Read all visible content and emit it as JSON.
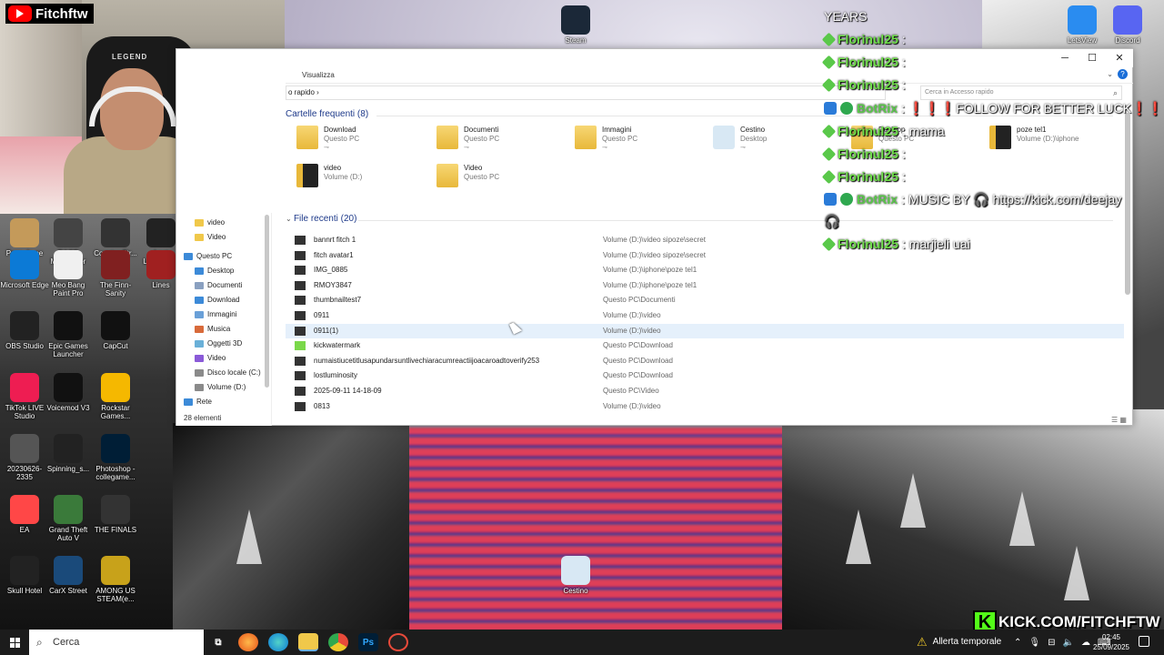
{
  "webcam": {
    "badge": "Fitchftw",
    "chair_text": "LEGEND"
  },
  "desktop_icons": [
    {
      "label": "Steam",
      "color": "#1b2838"
    },
    {
      "label": "LetsView",
      "color": "#2a8cf0"
    },
    {
      "label": "Discord",
      "color": "#5865f2"
    },
    {
      "label": "Poze de pe ipad al",
      "color": "#c49a5a"
    },
    {
      "label": "RAGE Multiplayer",
      "color": "#444"
    },
    {
      "label": "Counter-Str...",
      "color": "#333"
    },
    {
      "label": "Lost Luminosi...",
      "color": "#222"
    },
    {
      "label": "Microsoft Edge",
      "color": "#0c7ad6"
    },
    {
      "label": "Meo Bang Paint Pro",
      "color": "#f0f0f0"
    },
    {
      "label": "The Finn-Sanity",
      "color": "#802020"
    },
    {
      "label": "Lines",
      "color": "#a02020"
    },
    {
      "label": "OBS Studio",
      "color": "#222"
    },
    {
      "label": "Epic Games Launcher",
      "color": "#111"
    },
    {
      "label": "CapCut",
      "color": "#111"
    },
    {
      "label": "TikTok LIVE Studio",
      "color": "#ee1d52"
    },
    {
      "label": "Voicemod V3",
      "color": "#111"
    },
    {
      "label": "Rockstar Games...",
      "color": "#f5b800"
    },
    {
      "label": "20230626-2335",
      "color": "#555"
    },
    {
      "label": "Spinning_s...",
      "color": "#222"
    },
    {
      "label": "Photoshop - collegame...",
      "color": "#001e36"
    },
    {
      "label": "EA",
      "color": "#ff4747"
    },
    {
      "label": "Grand Theft Auto V",
      "color": "#3a7a3a"
    },
    {
      "label": "THE FINALS",
      "color": "#333"
    },
    {
      "label": "Skull Hotel",
      "color": "#222"
    },
    {
      "label": "CarX Street",
      "color": "#1a4a7a"
    },
    {
      "label": "AMONG US STEAM(e...",
      "color": "#c8a21a"
    },
    {
      "label": "Cestino",
      "color": "#d8e8f4"
    }
  ],
  "explorer": {
    "ribbon_tab": "Visualizza",
    "address": "o rapido  ›",
    "search_placeholder": "Cerca in Accesso rapido",
    "nav": [
      {
        "label": "video",
        "color": "#f0c84a"
      },
      {
        "label": "Video",
        "color": "#f0c84a"
      },
      {
        "label": "Questo PC",
        "color": "#3c8ad8"
      },
      {
        "label": "Desktop",
        "color": "#3c8ad8"
      },
      {
        "label": "Documenti",
        "color": "#8aa0c0"
      },
      {
        "label": "Download",
        "color": "#3c8ad8"
      },
      {
        "label": "Immagini",
        "color": "#6aa0d8"
      },
      {
        "label": "Musica",
        "color": "#d86a3a"
      },
      {
        "label": "Oggetti 3D",
        "color": "#6ab0d8"
      },
      {
        "label": "Video",
        "color": "#8a5ad8"
      },
      {
        "label": "Disco locale (C:)",
        "color": "#8a8a8a"
      },
      {
        "label": "Volume (D:)",
        "color": "#8a8a8a"
      },
      {
        "label": "Rete",
        "color": "#3c8ad8"
      }
    ],
    "status": "28 elementi",
    "frequent_header": "Cartelle frequenti (8)",
    "frequent": [
      {
        "name": "Download",
        "sub": "Questo PC"
      },
      {
        "name": "Documenti",
        "sub": "Questo PC"
      },
      {
        "name": "Immagini",
        "sub": "Questo PC"
      },
      {
        "name": "Cestino",
        "sub": "Desktop"
      },
      {
        "name": "Desktop",
        "sub": "Questo PC"
      },
      {
        "name": "poze tel1",
        "sub": "Volume (D:)\\iphone"
      },
      {
        "name": "video",
        "sub": "Volume (D:)"
      },
      {
        "name": "Video",
        "sub": "Questo PC"
      }
    ],
    "recent_header": "File recenti (20)",
    "recent": [
      {
        "name": "bannrt fitch 1",
        "loc": "Volume (D:)\\video sipoze\\secret"
      },
      {
        "name": "fitch avatar1",
        "loc": "Volume (D:)\\video sipoze\\secret"
      },
      {
        "name": "IMG_0885",
        "loc": "Volume (D:)\\iphone\\poze tel1"
      },
      {
        "name": "RMOY3847",
        "loc": "Volume (D:)\\iphone\\poze tel1"
      },
      {
        "name": "thumbnailtest7",
        "loc": "Questo PC\\Documenti"
      },
      {
        "name": "0911",
        "loc": "Volume (D:)\\video"
      },
      {
        "name": "0911(1)",
        "loc": "Volume (D:)\\video"
      },
      {
        "name": "kickwatermark",
        "loc": "Questo PC\\Download"
      },
      {
        "name": "numaistiucetitlusapundarsuntlivechiaracumreactiijoacaroadtoverify253",
        "loc": "Questo PC\\Download"
      },
      {
        "name": "lostluminosity",
        "loc": "Questo PC\\Download"
      },
      {
        "name": "2025-09-11 14-18-09",
        "loc": "Questo PC\\Video"
      },
      {
        "name": "0813",
        "loc": "Volume (D:)\\video"
      }
    ]
  },
  "chat": [
    {
      "user": "",
      "msg": "YEARS",
      "type": "msg"
    },
    {
      "user": "Florinul25",
      "msg": ":",
      "type": "user"
    },
    {
      "user": "Florinul25",
      "msg": ":",
      "type": "user"
    },
    {
      "user": "Florinul25",
      "msg": ":",
      "type": "user"
    },
    {
      "user": "BotRix",
      "msg": ": ❗❗❗FOLLOW FOR BETTER LUCK❗❗❗",
      "type": "bot"
    },
    {
      "user": "Florinul25",
      "msg": ": mama",
      "type": "user"
    },
    {
      "user": "Florinul25",
      "msg": ":",
      "type": "user"
    },
    {
      "user": "Florinul25",
      "msg": ":",
      "type": "user"
    },
    {
      "user": "BotRix",
      "msg": ": MUSIC BY 🎧 https://kick.com/deejay",
      "type": "bot"
    },
    {
      "user": "",
      "msg": "🎧",
      "type": "msg"
    },
    {
      "user": "Florinul25",
      "msg": ": marjieli uai",
      "type": "user"
    }
  ],
  "taskbar": {
    "search": "Cerca",
    "weather": "Allerta temporale",
    "time": "02:45",
    "date": "25/09/2025"
  },
  "kick": {
    "text": "KICK.COM/FITCHFTW",
    "letter": "K"
  }
}
